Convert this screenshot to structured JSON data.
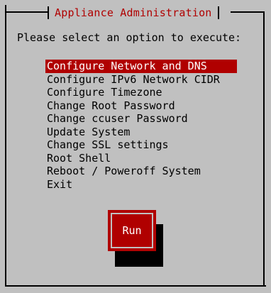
{
  "dialog": {
    "title": "Appliance Administration",
    "prompt": "Please select an option to execute:"
  },
  "menu": {
    "selected_index": 0,
    "items": [
      {
        "label": "Configure Network and DNS"
      },
      {
        "label": "Configure IPv6 Network CIDR"
      },
      {
        "label": "Configure Timezone"
      },
      {
        "label": "Change Root Password"
      },
      {
        "label": "Change ccuser Password"
      },
      {
        "label": "Update System"
      },
      {
        "label": "Change SSL settings"
      },
      {
        "label": "Root Shell"
      },
      {
        "label": "Reboot / Poweroff System"
      },
      {
        "label": "Exit"
      }
    ]
  },
  "buttons": {
    "run_label": "Run"
  },
  "colors": {
    "background": "#c0c0c0",
    "accent": "#b00000",
    "text": "#000000",
    "selected_text": "#ffffff"
  }
}
